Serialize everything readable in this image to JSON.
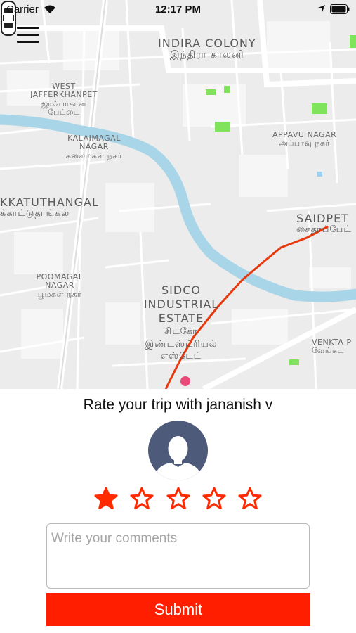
{
  "status_bar": {
    "carrier": "Carrier",
    "time": "12:17 PM"
  },
  "map": {
    "labels": {
      "indira_colony": "INDIRA COLONY",
      "indira_colony_ta": "இந்திரா காலனி",
      "west_jafferkhanpet": "WEST JAFFERKHANPET",
      "west_jafferkhanpet_ta": "ஜாஃபர்கான் பேட்டை",
      "kalaimagal_nagar": "KALAIMAGAL NAGAR",
      "kalaimagal_nagar_ta": "கலைமகள் நகர்",
      "appavu_nagar": "APPAVU NAGAR",
      "appavu_nagar_ta": "அப்பாவு நகர்",
      "kkatuthangal": "KKATUTHANGAL",
      "kkatuthangal_ta": "க்காட்டுதாங்கல்",
      "saidapet": "SAIDPET",
      "saidapet_ta": "சைதாப்பேட்",
      "poomagal_nagar": "POOMAGAL NAGAR",
      "poomagal_nagar_ta": "பூமகள் நகர்",
      "sidco": "SIDCO INDUSTRIAL ESTATE",
      "sidco_ta": "சிட்கோ இண்டஸ்ட்ரியல் எஸ்டேட்",
      "venkta": "VENKTA P",
      "venkta_ta": "வேங்கட"
    }
  },
  "rating": {
    "title": "Rate your trip with jananish v",
    "stars": 1,
    "max_stars": 5,
    "comments_placeholder": "Write your comments",
    "submit_label": "Submit"
  },
  "colors": {
    "accent": "#ff1f00",
    "star": "#ff2a00",
    "route": "#e8380d",
    "river": "#a9d5e8",
    "avatar_bg": "#4e5a79",
    "park": "#7fe35b"
  }
}
